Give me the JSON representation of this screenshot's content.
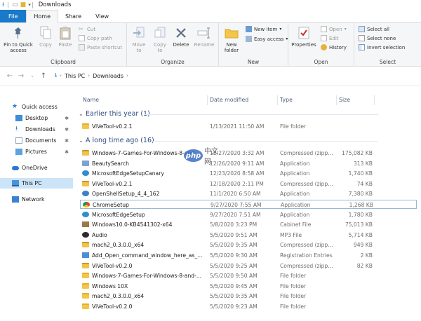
{
  "window": {
    "title": "Downloads"
  },
  "ribbon": {
    "tabs": [
      "File",
      "Home",
      "Share",
      "View"
    ],
    "groups": {
      "clipboard": {
        "label": "Clipboard",
        "pin": "Pin to Quick access",
        "copy": "Copy",
        "paste": "Paste",
        "cut": "Cut",
        "copy_path": "Copy path",
        "paste_shortcut": "Paste shortcut"
      },
      "organize": {
        "label": "Organize",
        "move_to": "Move to",
        "copy_to": "Copy to",
        "delete": "Delete",
        "rename": "Rename"
      },
      "new": {
        "label": "New",
        "new_folder": "New folder",
        "new_item": "New item",
        "easy_access": "Easy access"
      },
      "open": {
        "label": "Open",
        "properties": "Properties",
        "open": "Open",
        "edit": "Edit",
        "history": "History"
      },
      "select": {
        "label": "Select",
        "select_all": "Select all",
        "select_none": "Select none",
        "invert": "Invert selection"
      }
    }
  },
  "address": {
    "crumbs": [
      "This PC",
      "Downloads"
    ]
  },
  "nav": {
    "items": [
      {
        "label": "Quick access",
        "icon": "star-icon"
      },
      {
        "label": "Desktop",
        "icon": "desktop-icon"
      },
      {
        "label": "Downloads",
        "icon": "download-icon"
      },
      {
        "label": "Documents",
        "icon": "documents-icon"
      },
      {
        "label": "Pictures",
        "icon": "pictures-icon"
      },
      {
        "label": "OneDrive",
        "icon": "cloud-icon"
      },
      {
        "label": "This PC",
        "icon": "computer-icon"
      },
      {
        "label": "Network",
        "icon": "network-icon"
      }
    ]
  },
  "columns": {
    "name": "Name",
    "date": "Date modified",
    "type": "Type",
    "size": "Size"
  },
  "groups": [
    {
      "label": "Earlier this year (1)",
      "files": [
        {
          "name": "ViVeTool-v0.2.1",
          "date": "1/13/2021 11:50 AM",
          "type": "File folder",
          "size": "",
          "icon": "folder"
        }
      ]
    },
    {
      "label": "A long time ago (16)",
      "files": [
        {
          "name": "Windows-7-Games-For-Windows-8-and-...",
          "date": "12/27/2020 3:32 AM",
          "type": "Compressed (zipp...",
          "size": "175,082 KB",
          "icon": "zip"
        },
        {
          "name": "BeautySearch",
          "date": "12/26/2020 9:11 AM",
          "type": "Application",
          "size": "313 KB",
          "icon": "app"
        },
        {
          "name": "MicrosoftEdgeSetupCanary",
          "date": "12/23/2020 8:58 AM",
          "type": "Application",
          "size": "1,740 KB",
          "icon": "edge"
        },
        {
          "name": "ViVeTool-v0.2.1",
          "date": "12/18/2020 2:11 PM",
          "type": "Compressed (zipp...",
          "size": "74 KB",
          "icon": "zip"
        },
        {
          "name": "OpenShellSetup_4_4_162",
          "date": "11/1/2020 6:50 AM",
          "type": "Application",
          "size": "7,380 KB",
          "icon": "shell"
        },
        {
          "name": "ChromeSetup",
          "date": "9/27/2020 7:55 AM",
          "type": "Application",
          "size": "1,268 KB",
          "icon": "chrome"
        },
        {
          "name": "MicrosoftEdgeSetup",
          "date": "9/27/2020 7:51 AM",
          "type": "Application",
          "size": "1,780 KB",
          "icon": "edge"
        },
        {
          "name": "Windows10.0-KB4541302-x64",
          "date": "5/8/2020 3:23 PM",
          "type": "Cabinet File",
          "size": "75,013 KB",
          "icon": "cab"
        },
        {
          "name": "Audio",
          "date": "5/5/2020 9:51 AM",
          "type": "MP3 File",
          "size": "5,714 KB",
          "icon": "audio"
        },
        {
          "name": "mach2_0.3.0.0_x64",
          "date": "5/5/2020 9:35 AM",
          "type": "Compressed (zipp...",
          "size": "949 KB",
          "icon": "zip"
        },
        {
          "name": "Add_Open_command_window_here_as_...",
          "date": "5/5/2020 9:30 AM",
          "type": "Registration Entries",
          "size": "2 KB",
          "icon": "reg"
        },
        {
          "name": "ViVeTool-v0.2.0",
          "date": "5/5/2020 9:25 AM",
          "type": "Compressed (zipp...",
          "size": "82 KB",
          "icon": "zip"
        },
        {
          "name": "Windows-7-Games-For-Windows-8-and-...",
          "date": "5/5/2020 9:50 AM",
          "type": "File folder",
          "size": "",
          "icon": "folder"
        },
        {
          "name": "Windows 10X",
          "date": "5/5/2020 9:45 AM",
          "type": "File folder",
          "size": "",
          "icon": "folder"
        },
        {
          "name": "mach2_0.3.0.0_x64",
          "date": "5/5/2020 9:35 AM",
          "type": "File folder",
          "size": "",
          "icon": "folder"
        },
        {
          "name": "ViVeTool-v0.2.0",
          "date": "5/5/2020 9:23 AM",
          "type": "File folder",
          "size": "",
          "icon": "folder"
        }
      ]
    }
  ],
  "watermark": {
    "logo": "php",
    "text": "中文网"
  }
}
